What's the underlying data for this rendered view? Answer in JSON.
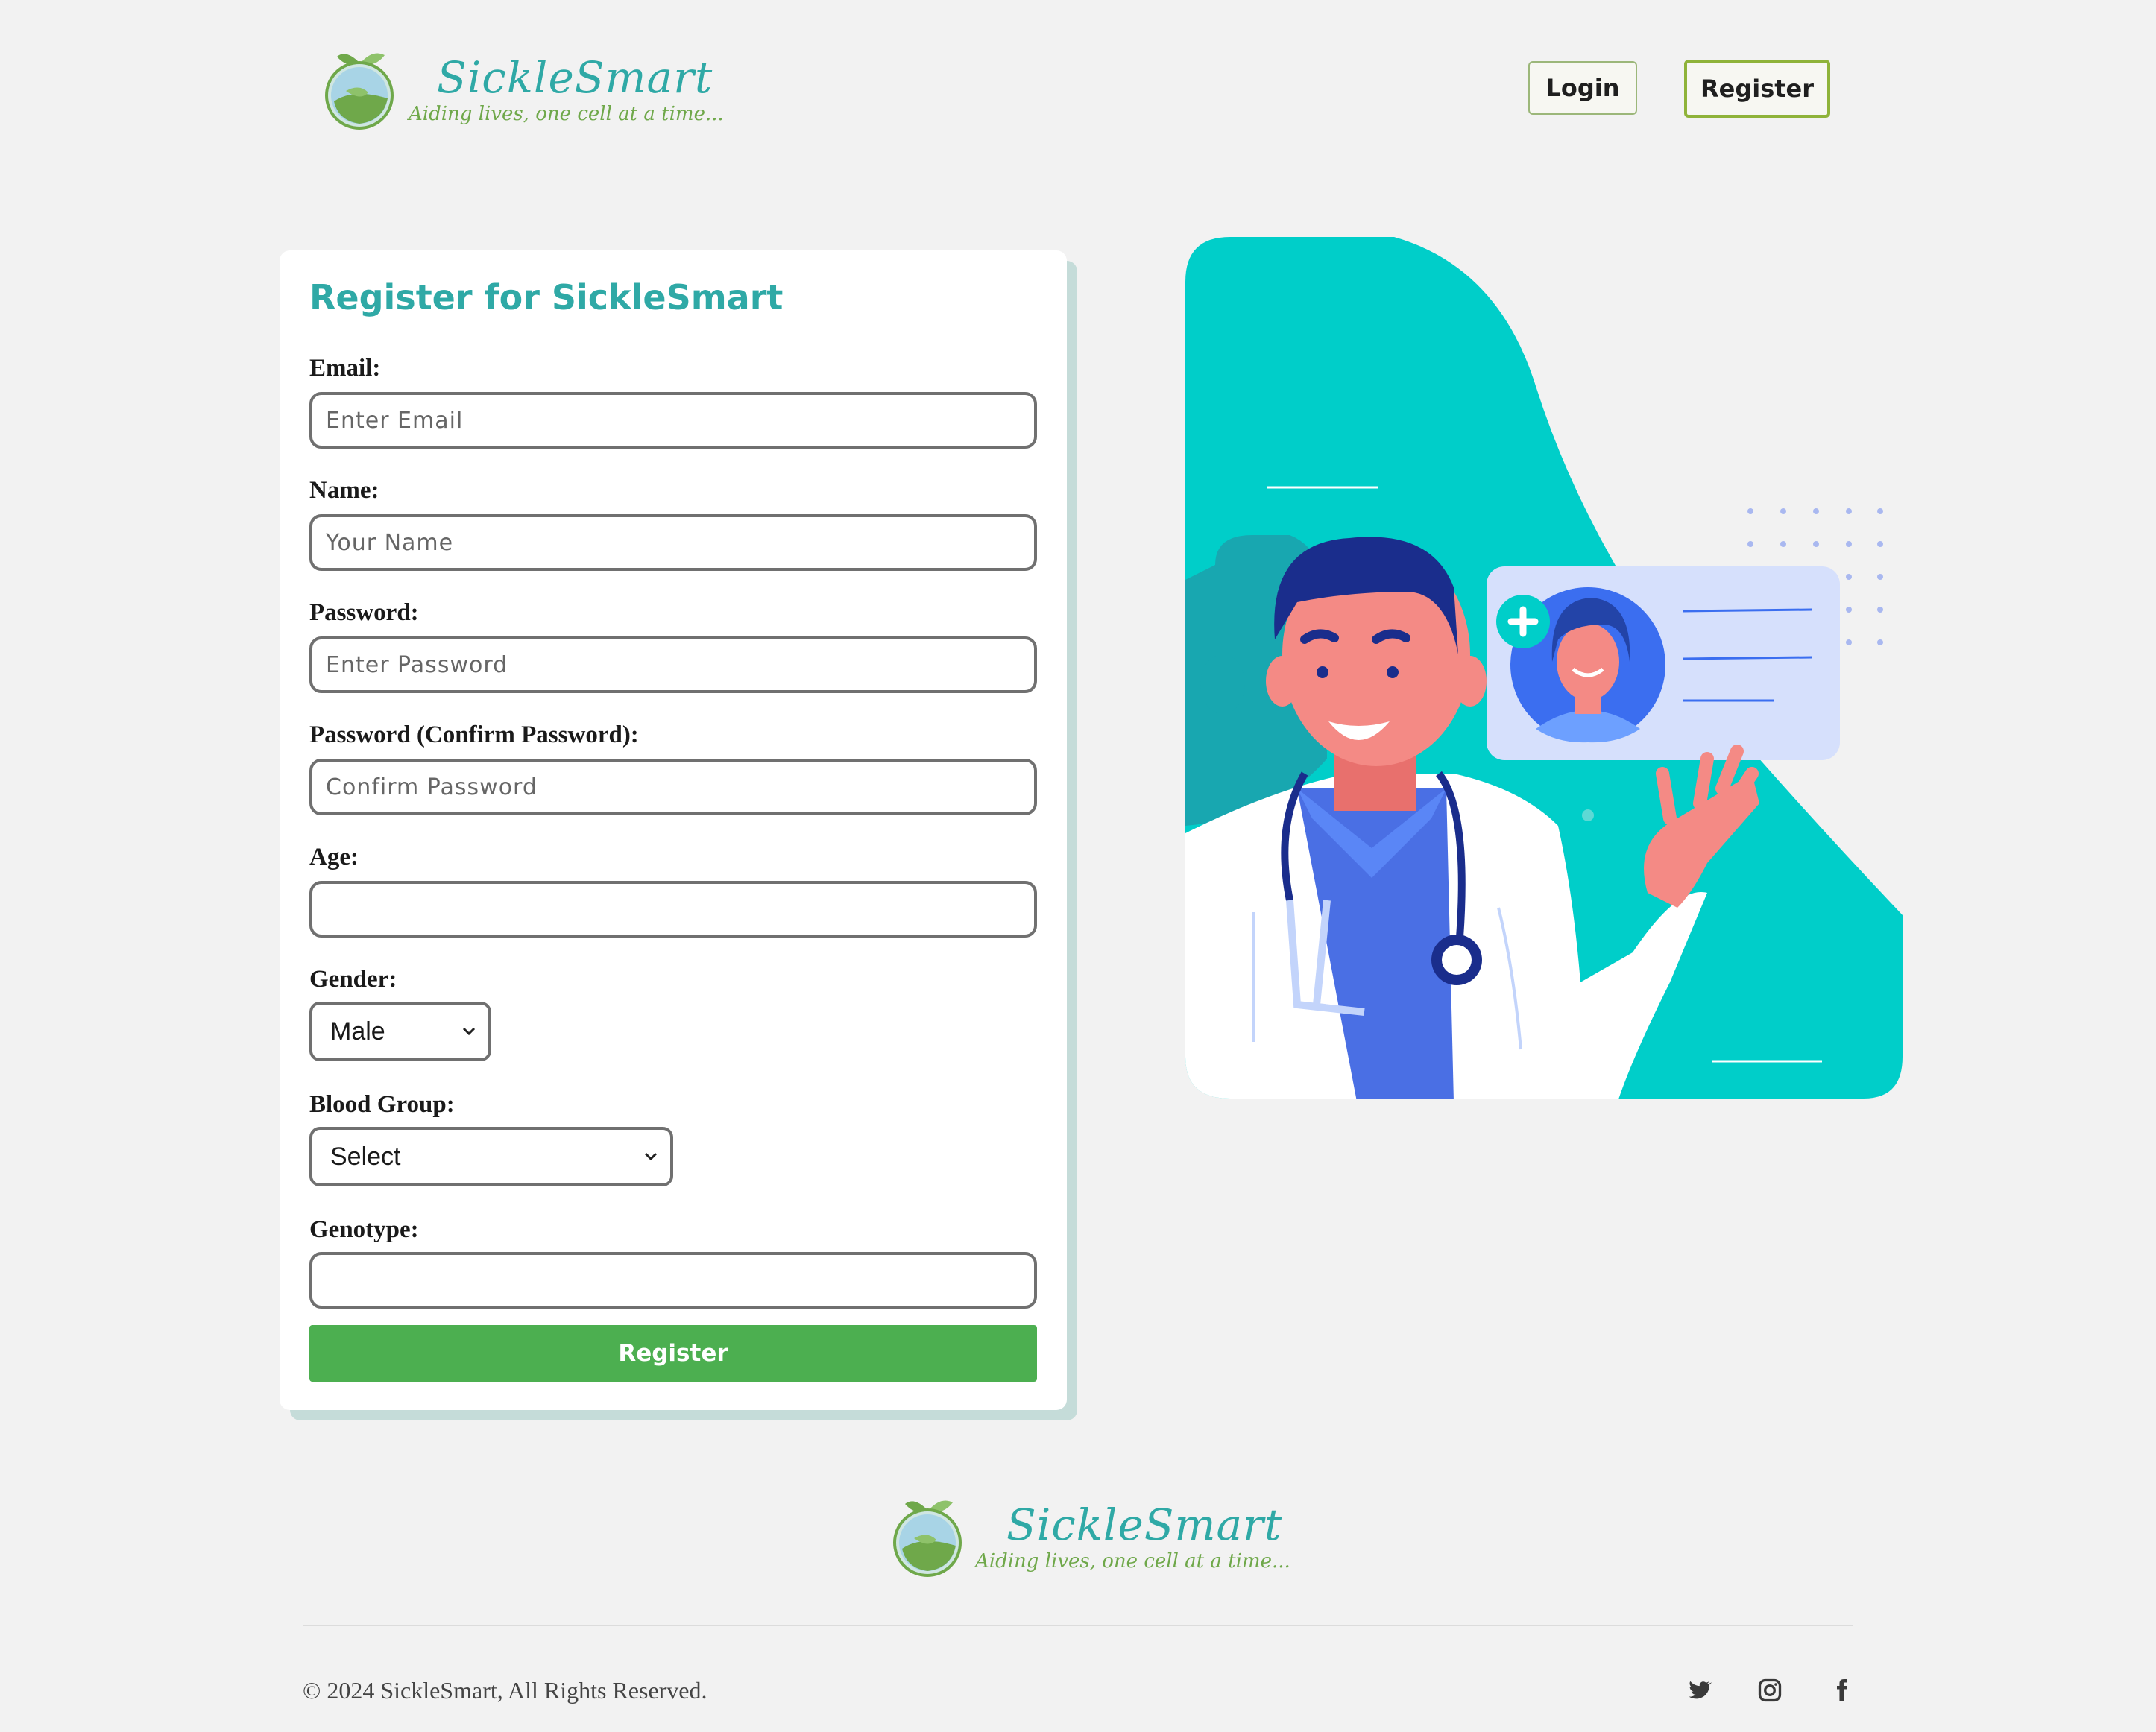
{
  "header": {
    "brand": "SickleSmart",
    "tagline": "Aiding lives, one cell at a time...",
    "login_label": "Login",
    "register_label": "Register"
  },
  "form": {
    "title": "Register for SickleSmart",
    "email": {
      "label": "Email:",
      "placeholder": "Enter Email",
      "value": ""
    },
    "name": {
      "label": "Name:",
      "placeholder": "Your Name",
      "value": ""
    },
    "password": {
      "label": "Password:",
      "placeholder": "Enter Password",
      "value": ""
    },
    "confirm_password": {
      "label": "Password (Confirm Password):",
      "placeholder": "Confirm Password",
      "value": ""
    },
    "age": {
      "label": "Age:",
      "value": ""
    },
    "gender": {
      "label": "Gender:",
      "selected": "Male"
    },
    "blood_group": {
      "label": "Blood Group:",
      "selected": "Select"
    },
    "genotype": {
      "label": "Genotype:",
      "value": ""
    },
    "submit_label": "Register"
  },
  "footer": {
    "brand": "SickleSmart",
    "tagline": "Aiding lives, one cell at a time...",
    "copyright": "© 2024 SickleSmart, All Rights Reserved.",
    "social": [
      "twitter-icon",
      "instagram-icon",
      "facebook-icon"
    ]
  },
  "colors": {
    "accent": "#2fa9a6",
    "submit": "#4caf50",
    "hero_teal": "#00cec9",
    "page_bg": "#f2f2f2"
  }
}
